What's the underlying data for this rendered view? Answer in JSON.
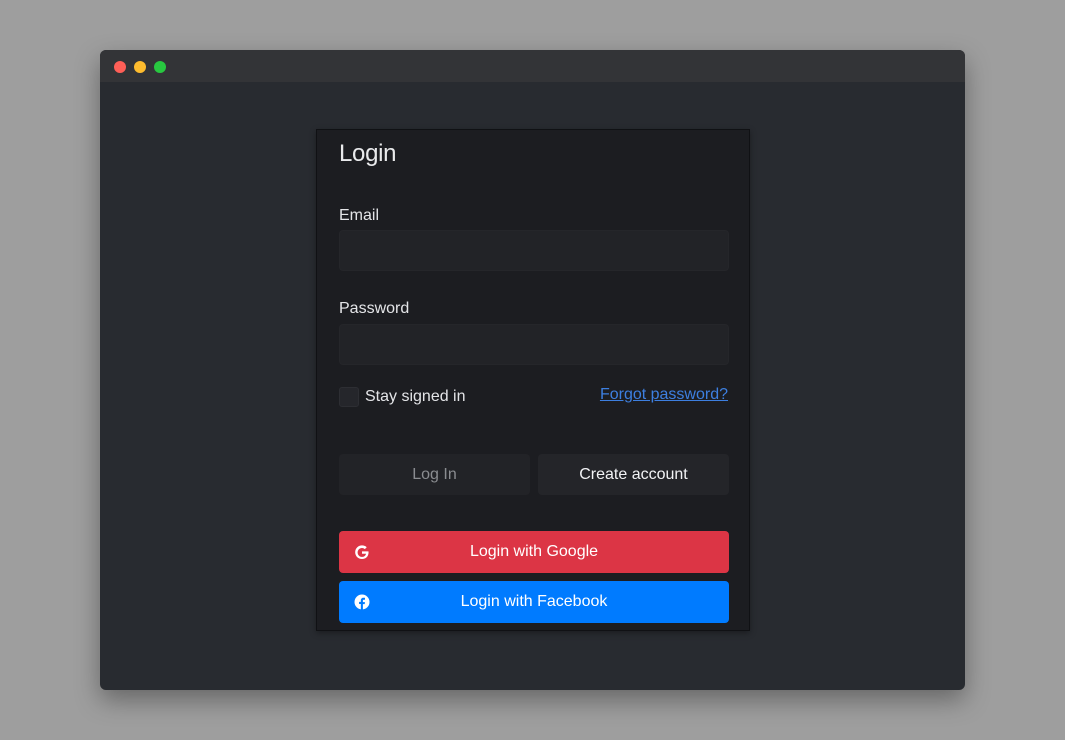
{
  "window": {
    "controls": [
      "close",
      "minimize",
      "maximize"
    ]
  },
  "login_card": {
    "title": "Login",
    "email": {
      "label": "Email",
      "value": "",
      "placeholder": ""
    },
    "password": {
      "label": "Password",
      "value": "",
      "placeholder": ""
    },
    "stay_signed_in": {
      "label": "Stay signed in",
      "checked": false
    },
    "forgot_password_link": "Forgot password?",
    "buttons": {
      "login": "Log In",
      "create_account": "Create account",
      "google": "Login with Google",
      "facebook": "Login with Facebook"
    },
    "icons": {
      "google": "google-icon",
      "facebook": "facebook-icon"
    }
  },
  "colors": {
    "google": "#dc3545",
    "facebook": "#007bff",
    "link": "#3d7fe0"
  }
}
